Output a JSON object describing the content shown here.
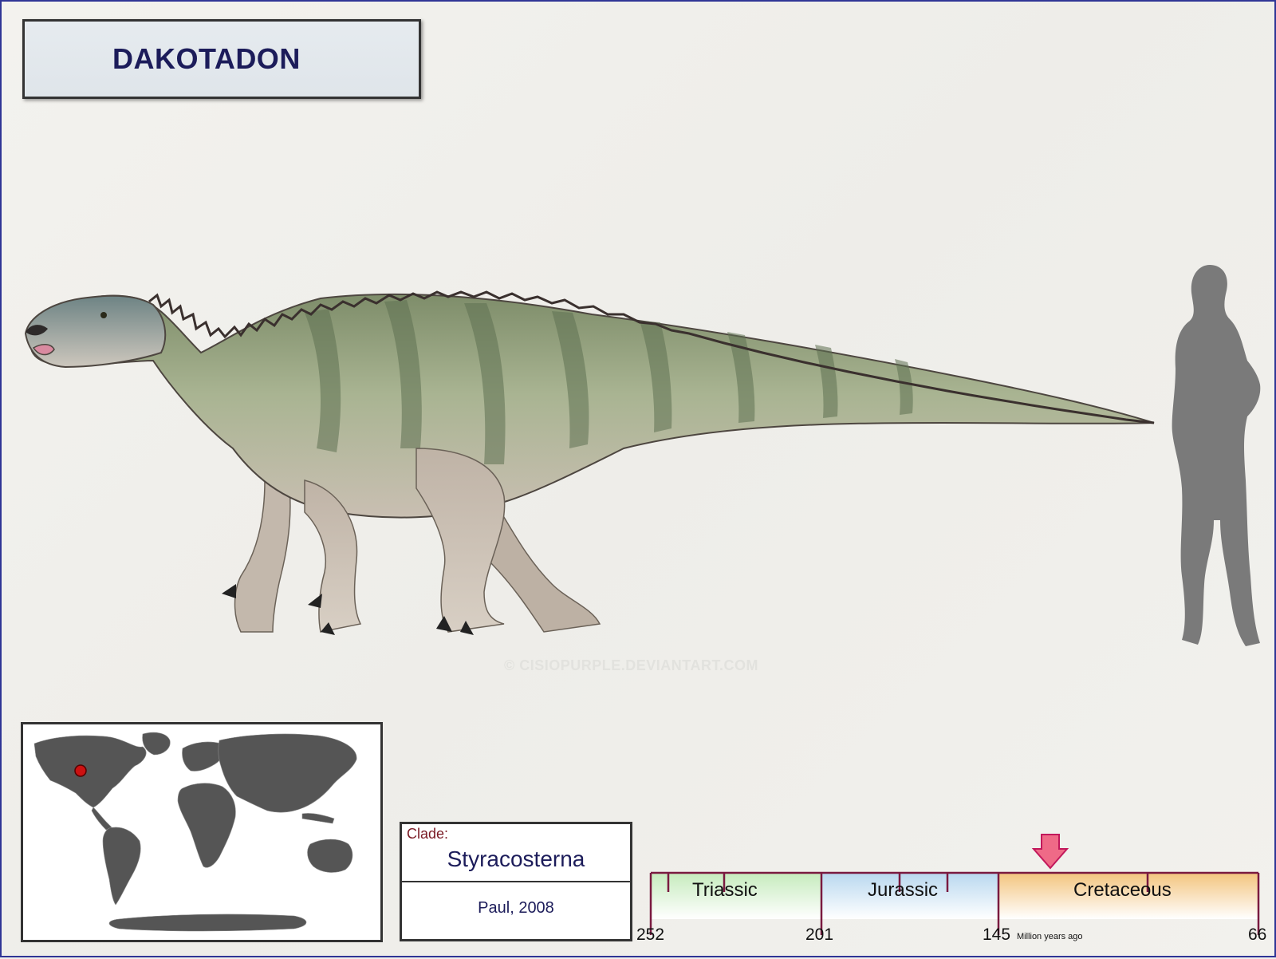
{
  "title": "DAKOTADON",
  "watermark": "© CISIOPURPLE.DEVIANTART.COM",
  "illustration": {
    "subject": "dinosaur-side-view",
    "scale_reference": "human-silhouette"
  },
  "map": {
    "icon": "world-map-icon",
    "marker_color": "#cc1111",
    "land_color": "#555555"
  },
  "clade": {
    "label": "Clade:",
    "name": "Styracosterna",
    "author": "Paul, 2008"
  },
  "timeline": {
    "periods": [
      {
        "name": "Triassic",
        "color": "#cfeec7"
      },
      {
        "name": "Jurassic",
        "color": "#c6dff0"
      },
      {
        "name": "Cretaceous",
        "color": "#f4cf8f"
      }
    ],
    "ticks": [
      "252",
      "201",
      "145",
      "66"
    ],
    "unit": "Million years ago",
    "border_color": "#7a1a40",
    "arrow_color": "#ef6a87"
  }
}
